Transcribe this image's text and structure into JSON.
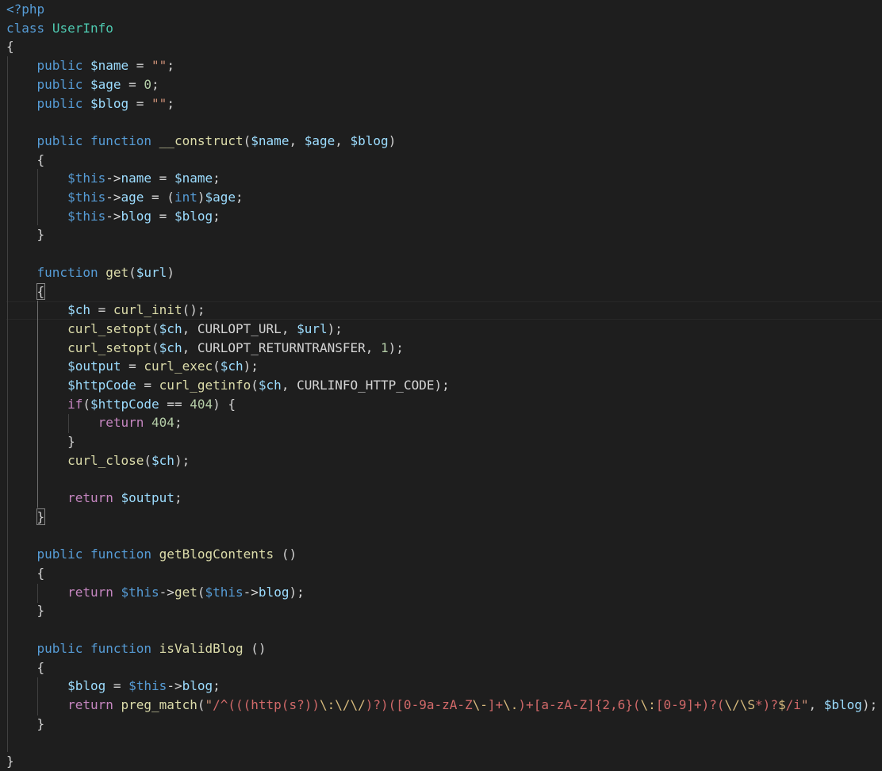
{
  "editor": {
    "language": "php",
    "colors": {
      "background": "#1e1e1e",
      "keyword": "#569cd6",
      "control": "#c586c0",
      "variable": "#9cdcfe",
      "function": "#dcdcaa",
      "class": "#4ec9b0",
      "string": "#ce9178",
      "regex": "#d16969",
      "number": "#b5cea8",
      "text": "#d4d4d4"
    },
    "lines": [
      {
        "tokens": [
          {
            "t": "kw",
            "v": "<?php"
          }
        ]
      },
      {
        "tokens": [
          {
            "t": "kw",
            "v": "class"
          },
          {
            "t": "op",
            "v": " "
          },
          {
            "t": "cls",
            "v": "UserInfo"
          }
        ]
      },
      {
        "tokens": [
          {
            "t": "punc",
            "v": "{"
          }
        ]
      },
      {
        "tokens": [
          {
            "t": "op",
            "v": "    "
          },
          {
            "t": "kw",
            "v": "public"
          },
          {
            "t": "op",
            "v": " "
          },
          {
            "t": "var",
            "v": "$name"
          },
          {
            "t": "op",
            "v": " = "
          },
          {
            "t": "str",
            "v": "\"\""
          },
          {
            "t": "punc",
            "v": ";"
          }
        ]
      },
      {
        "tokens": [
          {
            "t": "op",
            "v": "    "
          },
          {
            "t": "kw",
            "v": "public"
          },
          {
            "t": "op",
            "v": " "
          },
          {
            "t": "var",
            "v": "$age"
          },
          {
            "t": "op",
            "v": " = "
          },
          {
            "t": "num",
            "v": "0"
          },
          {
            "t": "punc",
            "v": ";"
          }
        ]
      },
      {
        "tokens": [
          {
            "t": "op",
            "v": "    "
          },
          {
            "t": "kw",
            "v": "public"
          },
          {
            "t": "op",
            "v": " "
          },
          {
            "t": "var",
            "v": "$blog"
          },
          {
            "t": "op",
            "v": " = "
          },
          {
            "t": "str",
            "v": "\"\""
          },
          {
            "t": "punc",
            "v": ";"
          }
        ]
      },
      {
        "tokens": []
      },
      {
        "tokens": [
          {
            "t": "op",
            "v": "    "
          },
          {
            "t": "kw",
            "v": "public"
          },
          {
            "t": "op",
            "v": " "
          },
          {
            "t": "kw",
            "v": "function"
          },
          {
            "t": "op",
            "v": " "
          },
          {
            "t": "fn",
            "v": "__construct"
          },
          {
            "t": "punc",
            "v": "("
          },
          {
            "t": "var",
            "v": "$name"
          },
          {
            "t": "punc",
            "v": ", "
          },
          {
            "t": "var",
            "v": "$age"
          },
          {
            "t": "punc",
            "v": ", "
          },
          {
            "t": "var",
            "v": "$blog"
          },
          {
            "t": "punc",
            "v": ")"
          }
        ]
      },
      {
        "tokens": [
          {
            "t": "op",
            "v": "    "
          },
          {
            "t": "punc",
            "v": "{"
          }
        ]
      },
      {
        "tokens": [
          {
            "t": "op",
            "v": "        "
          },
          {
            "t": "this",
            "v": "$this"
          },
          {
            "t": "op",
            "v": "->"
          },
          {
            "t": "var",
            "v": "name"
          },
          {
            "t": "op",
            "v": " = "
          },
          {
            "t": "var",
            "v": "$name"
          },
          {
            "t": "punc",
            "v": ";"
          }
        ]
      },
      {
        "tokens": [
          {
            "t": "op",
            "v": "        "
          },
          {
            "t": "this",
            "v": "$this"
          },
          {
            "t": "op",
            "v": "->"
          },
          {
            "t": "var",
            "v": "age"
          },
          {
            "t": "op",
            "v": " = ("
          },
          {
            "t": "kw",
            "v": "int"
          },
          {
            "t": "op",
            "v": ")"
          },
          {
            "t": "var",
            "v": "$age"
          },
          {
            "t": "punc",
            "v": ";"
          }
        ]
      },
      {
        "tokens": [
          {
            "t": "op",
            "v": "        "
          },
          {
            "t": "this",
            "v": "$this"
          },
          {
            "t": "op",
            "v": "->"
          },
          {
            "t": "var",
            "v": "blog"
          },
          {
            "t": "op",
            "v": " = "
          },
          {
            "t": "var",
            "v": "$blog"
          },
          {
            "t": "punc",
            "v": ";"
          }
        ]
      },
      {
        "tokens": [
          {
            "t": "op",
            "v": "    "
          },
          {
            "t": "punc",
            "v": "}"
          }
        ]
      },
      {
        "tokens": []
      },
      {
        "tokens": [
          {
            "t": "op",
            "v": "    "
          },
          {
            "t": "kw",
            "v": "function"
          },
          {
            "t": "op",
            "v": " "
          },
          {
            "t": "fn",
            "v": "get"
          },
          {
            "t": "punc",
            "v": "("
          },
          {
            "t": "var",
            "v": "$url"
          },
          {
            "t": "punc",
            "v": ")"
          }
        ]
      },
      {
        "tokens": [
          {
            "t": "op",
            "v": "    "
          },
          {
            "t": "punc",
            "v": "{",
            "m": true
          }
        ]
      },
      {
        "tokens": [
          {
            "t": "op",
            "v": "        "
          },
          {
            "t": "var",
            "v": "$ch"
          },
          {
            "t": "op",
            "v": " = "
          },
          {
            "t": "fn",
            "v": "curl_init"
          },
          {
            "t": "punc",
            "v": "();"
          }
        ]
      },
      {
        "tokens": [
          {
            "t": "op",
            "v": "        "
          },
          {
            "t": "fn",
            "v": "curl_setopt"
          },
          {
            "t": "punc",
            "v": "("
          },
          {
            "t": "var",
            "v": "$ch"
          },
          {
            "t": "punc",
            "v": ", "
          },
          {
            "t": "const",
            "v": "CURLOPT_URL"
          },
          {
            "t": "punc",
            "v": ", "
          },
          {
            "t": "var",
            "v": "$url"
          },
          {
            "t": "punc",
            "v": ");"
          }
        ]
      },
      {
        "tokens": [
          {
            "t": "op",
            "v": "        "
          },
          {
            "t": "fn",
            "v": "curl_setopt"
          },
          {
            "t": "punc",
            "v": "("
          },
          {
            "t": "var",
            "v": "$ch"
          },
          {
            "t": "punc",
            "v": ", "
          },
          {
            "t": "const",
            "v": "CURLOPT_RETURNTRANSFER"
          },
          {
            "t": "punc",
            "v": ", "
          },
          {
            "t": "num",
            "v": "1"
          },
          {
            "t": "punc",
            "v": ");"
          }
        ]
      },
      {
        "tokens": [
          {
            "t": "op",
            "v": "        "
          },
          {
            "t": "var",
            "v": "$output"
          },
          {
            "t": "op",
            "v": " = "
          },
          {
            "t": "fn",
            "v": "curl_exec"
          },
          {
            "t": "punc",
            "v": "("
          },
          {
            "t": "var",
            "v": "$ch"
          },
          {
            "t": "punc",
            "v": ");"
          }
        ]
      },
      {
        "tokens": [
          {
            "t": "op",
            "v": "        "
          },
          {
            "t": "var",
            "v": "$httpCode"
          },
          {
            "t": "op",
            "v": " = "
          },
          {
            "t": "fn",
            "v": "curl_getinfo"
          },
          {
            "t": "punc",
            "v": "("
          },
          {
            "t": "var",
            "v": "$ch"
          },
          {
            "t": "punc",
            "v": ", "
          },
          {
            "t": "const",
            "v": "CURLINFO_HTTP_CODE"
          },
          {
            "t": "punc",
            "v": ");"
          }
        ]
      },
      {
        "tokens": [
          {
            "t": "op",
            "v": "        "
          },
          {
            "t": "ctl",
            "v": "if"
          },
          {
            "t": "punc",
            "v": "("
          },
          {
            "t": "var",
            "v": "$httpCode"
          },
          {
            "t": "op",
            "v": " == "
          },
          {
            "t": "num",
            "v": "404"
          },
          {
            "t": "punc",
            "v": ") {"
          }
        ]
      },
      {
        "tokens": [
          {
            "t": "op",
            "v": "            "
          },
          {
            "t": "ctl",
            "v": "return"
          },
          {
            "t": "op",
            "v": " "
          },
          {
            "t": "num",
            "v": "404"
          },
          {
            "t": "punc",
            "v": ";"
          }
        ]
      },
      {
        "tokens": [
          {
            "t": "op",
            "v": "        "
          },
          {
            "t": "punc",
            "v": "}"
          }
        ]
      },
      {
        "tokens": [
          {
            "t": "op",
            "v": "        "
          },
          {
            "t": "fn",
            "v": "curl_close"
          },
          {
            "t": "punc",
            "v": "("
          },
          {
            "t": "var",
            "v": "$ch"
          },
          {
            "t": "punc",
            "v": ");"
          }
        ]
      },
      {
        "tokens": []
      },
      {
        "tokens": [
          {
            "t": "op",
            "v": "        "
          },
          {
            "t": "ctl",
            "v": "return"
          },
          {
            "t": "op",
            "v": " "
          },
          {
            "t": "var",
            "v": "$output"
          },
          {
            "t": "punc",
            "v": ";"
          }
        ]
      },
      {
        "tokens": [
          {
            "t": "op",
            "v": "    "
          },
          {
            "t": "punc",
            "v": "}",
            "m": true
          }
        ]
      },
      {
        "tokens": []
      },
      {
        "tokens": [
          {
            "t": "op",
            "v": "    "
          },
          {
            "t": "kw",
            "v": "public"
          },
          {
            "t": "op",
            "v": " "
          },
          {
            "t": "kw",
            "v": "function"
          },
          {
            "t": "op",
            "v": " "
          },
          {
            "t": "fn",
            "v": "getBlogContents"
          },
          {
            "t": "op",
            "v": " "
          },
          {
            "t": "punc",
            "v": "()"
          }
        ]
      },
      {
        "tokens": [
          {
            "t": "op",
            "v": "    "
          },
          {
            "t": "punc",
            "v": "{"
          }
        ]
      },
      {
        "tokens": [
          {
            "t": "op",
            "v": "        "
          },
          {
            "t": "ctl",
            "v": "return"
          },
          {
            "t": "op",
            "v": " "
          },
          {
            "t": "this",
            "v": "$this"
          },
          {
            "t": "op",
            "v": "->"
          },
          {
            "t": "fn",
            "v": "get"
          },
          {
            "t": "punc",
            "v": "("
          },
          {
            "t": "this",
            "v": "$this"
          },
          {
            "t": "op",
            "v": "->"
          },
          {
            "t": "var",
            "v": "blog"
          },
          {
            "t": "punc",
            "v": ");"
          }
        ]
      },
      {
        "tokens": [
          {
            "t": "op",
            "v": "    "
          },
          {
            "t": "punc",
            "v": "}"
          }
        ]
      },
      {
        "tokens": []
      },
      {
        "tokens": [
          {
            "t": "op",
            "v": "    "
          },
          {
            "t": "kw",
            "v": "public"
          },
          {
            "t": "op",
            "v": " "
          },
          {
            "t": "kw",
            "v": "function"
          },
          {
            "t": "op",
            "v": " "
          },
          {
            "t": "fn",
            "v": "isValidBlog"
          },
          {
            "t": "op",
            "v": " "
          },
          {
            "t": "punc",
            "v": "()"
          }
        ]
      },
      {
        "tokens": [
          {
            "t": "op",
            "v": "    "
          },
          {
            "t": "punc",
            "v": "{"
          }
        ]
      },
      {
        "tokens": [
          {
            "t": "op",
            "v": "        "
          },
          {
            "t": "var",
            "v": "$blog"
          },
          {
            "t": "op",
            "v": " = "
          },
          {
            "t": "this",
            "v": "$this"
          },
          {
            "t": "op",
            "v": "->"
          },
          {
            "t": "var",
            "v": "blog"
          },
          {
            "t": "punc",
            "v": ";"
          }
        ]
      },
      {
        "tokens": [
          {
            "t": "op",
            "v": "        "
          },
          {
            "t": "ctl",
            "v": "return"
          },
          {
            "t": "op",
            "v": " "
          },
          {
            "t": "fn",
            "v": "preg_match"
          },
          {
            "t": "punc",
            "v": "("
          },
          {
            "t": "str",
            "v": "\""
          },
          {
            "t": "re",
            "v": "/^(((http(s?))"
          },
          {
            "t": "esc",
            "v": "\\:\\/\\/"
          },
          {
            "t": "re",
            "v": ")?)([0-9a-zA-Z"
          },
          {
            "t": "esc",
            "v": "\\-"
          },
          {
            "t": "re",
            "v": "]+"
          },
          {
            "t": "esc",
            "v": "\\."
          },
          {
            "t": "re",
            "v": ")+[a-zA-Z]{2,6}("
          },
          {
            "t": "esc",
            "v": "\\:"
          },
          {
            "t": "re",
            "v": "[0-9]+)?("
          },
          {
            "t": "esc",
            "v": "\\/\\S"
          },
          {
            "t": "re",
            "v": "*)?"
          },
          {
            "t": "esc",
            "v": "$"
          },
          {
            "t": "re",
            "v": "/i"
          },
          {
            "t": "str",
            "v": "\""
          },
          {
            "t": "punc",
            "v": ", "
          },
          {
            "t": "var",
            "v": "$blog"
          },
          {
            "t": "punc",
            "v": ");"
          }
        ]
      },
      {
        "tokens": [
          {
            "t": "op",
            "v": "    "
          },
          {
            "t": "punc",
            "v": "}"
          }
        ]
      },
      {
        "tokens": []
      },
      {
        "tokens": [
          {
            "t": "punc",
            "v": "}"
          }
        ]
      }
    ]
  }
}
